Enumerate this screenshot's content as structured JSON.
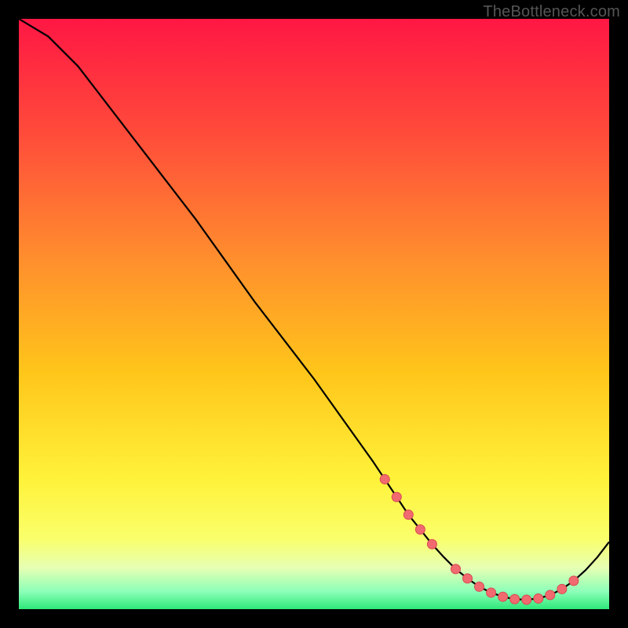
{
  "watermark": "TheBottleneck.com",
  "colors": {
    "background": "#000000",
    "gradient_stops": [
      {
        "offset": 0.0,
        "color": "#ff1744"
      },
      {
        "offset": 0.2,
        "color": "#ff4d3a"
      },
      {
        "offset": 0.4,
        "color": "#ff8c2e"
      },
      {
        "offset": 0.6,
        "color": "#ffc61a"
      },
      {
        "offset": 0.78,
        "color": "#fff23a"
      },
      {
        "offset": 0.88,
        "color": "#faff6a"
      },
      {
        "offset": 0.93,
        "color": "#e6ffb3"
      },
      {
        "offset": 0.97,
        "color": "#8cffb8"
      },
      {
        "offset": 1.0,
        "color": "#2ee879"
      }
    ],
    "curve": "#000000",
    "marker_fill": "#f16a6f",
    "marker_stroke": "#d84a52"
  },
  "chart_data": {
    "type": "line",
    "title": "",
    "xlabel": "",
    "ylabel": "",
    "xlim": [
      0,
      100
    ],
    "ylim": [
      0,
      100
    ],
    "series": [
      {
        "name": "curve",
        "x": [
          0,
          5,
          10,
          15,
          20,
          25,
          30,
          35,
          40,
          45,
          50,
          55,
          60,
          62,
          64,
          66,
          68,
          70,
          72,
          74,
          76,
          78,
          80,
          82,
          84,
          86,
          88,
          90,
          92,
          94,
          96,
          98,
          100
        ],
        "y": [
          100,
          97,
          92,
          85.5,
          79,
          72.5,
          66,
          59,
          52,
          45.5,
          39,
          32,
          25,
          22,
          19,
          16,
          13.5,
          11,
          8.8,
          6.8,
          5.2,
          3.8,
          2.8,
          2.1,
          1.7,
          1.6,
          1.8,
          2.4,
          3.4,
          4.8,
          6.6,
          8.8,
          11.4
        ]
      }
    ],
    "markers": {
      "name": "highlighted-range",
      "x": [
        62,
        64,
        66,
        68,
        70,
        74,
        76,
        78,
        80,
        82,
        84,
        86,
        88,
        90,
        92,
        94
      ],
      "y": [
        22,
        19,
        16,
        13.5,
        11,
        6.8,
        5.2,
        3.8,
        2.8,
        2.1,
        1.7,
        1.6,
        1.8,
        2.4,
        3.4,
        4.8
      ]
    }
  }
}
